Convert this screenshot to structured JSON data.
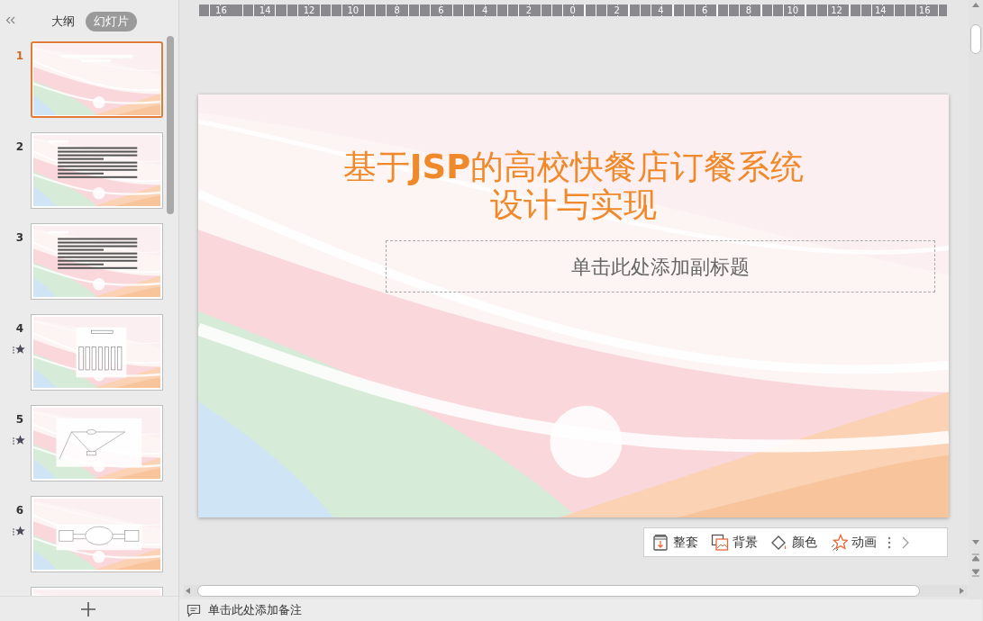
{
  "panel_tabs": [
    {
      "label": "大纲",
      "selected": false
    },
    {
      "label": "幻灯片",
      "selected": true
    }
  ],
  "slides": [
    {
      "number": "1",
      "selected": true,
      "animated": false,
      "kind": "title"
    },
    {
      "number": "2",
      "selected": false,
      "animated": false,
      "kind": "text"
    },
    {
      "number": "3",
      "selected": false,
      "animated": false,
      "kind": "text"
    },
    {
      "number": "4",
      "selected": false,
      "animated": true,
      "kind": "tree"
    },
    {
      "number": "5",
      "selected": false,
      "animated": true,
      "kind": "er"
    },
    {
      "number": "6",
      "selected": false,
      "animated": true,
      "kind": "flow"
    },
    {
      "selected": false,
      "animated": false,
      "kind": "partial"
    }
  ],
  "ruler": {
    "labels": [
      "16",
      "14",
      "12",
      "10",
      "8",
      "6",
      "4",
      "2",
      "0",
      "2",
      "4",
      "6",
      "8",
      "10",
      "12",
      "14",
      "16"
    ]
  },
  "slide": {
    "title_lines": [
      "基于**JSP**的高校快餐店订餐系统",
      "设计与实现"
    ],
    "subtitle_placeholder": "单击此处添加副标题"
  },
  "toolbar": [
    {
      "label": "整套",
      "kind": "suite"
    },
    {
      "label": "背景",
      "kind": "background"
    },
    {
      "label": "颜色",
      "kind": "color"
    },
    {
      "label": "动画",
      "kind": "animation"
    }
  ],
  "notes": {
    "placeholder": "单击此处添加备注"
  }
}
